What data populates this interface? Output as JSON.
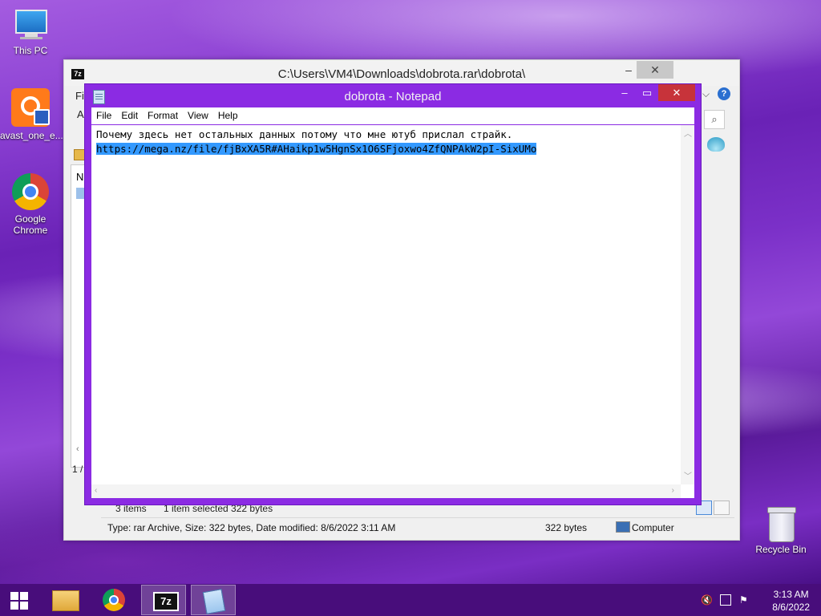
{
  "desktop_icons": [
    {
      "label": "This PC",
      "icon": "this-pc-icon"
    },
    {
      "label": "avast_one_e...",
      "icon": "avast-icon"
    },
    {
      "label": "Google Chrome",
      "icon": "chrome-icon"
    },
    {
      "label": "Recycle Bin",
      "icon": "recycle-bin-icon"
    }
  ],
  "zip_window": {
    "title": "C:\\Users\\VM4\\Downloads\\dobrota.rar\\dobrota\\",
    "app_icon_text": "7z",
    "left_partial": [
      "Fi",
      "A",
      "N",
      "1 /"
    ],
    "status_items": "3 items",
    "status_selected": "1 item selected  322 bytes",
    "status_type": "Type: rar Archive, Size: 322 bytes, Date modified: 8/6/2022 3:11 AM",
    "status_size": "322 bytes",
    "status_location": "Computer"
  },
  "notepad": {
    "title": "dobrota - Notepad",
    "menu": [
      "File",
      "Edit",
      "Format",
      "View",
      "Help"
    ],
    "line1": "Почему здесь нет остальных данных потому что мне ютуб прислал страйк.",
    "line2": "https://mega.nz/file/fjBxXA5R#AHaikp1w5HgnSx1O6SFjoxwo4ZfQNPAkW2pI-SixUMo"
  },
  "taskbar": {
    "items": [
      "start-button",
      "file-explorer",
      "chrome",
      "7zip",
      "notepad"
    ],
    "time": "3:13 AM",
    "date": "8/6/2022"
  },
  "colors": {
    "notepad_frame": "#8b2be3",
    "close_red": "#c7333a",
    "selection": "#3399ff",
    "taskbar": "#460c78"
  }
}
